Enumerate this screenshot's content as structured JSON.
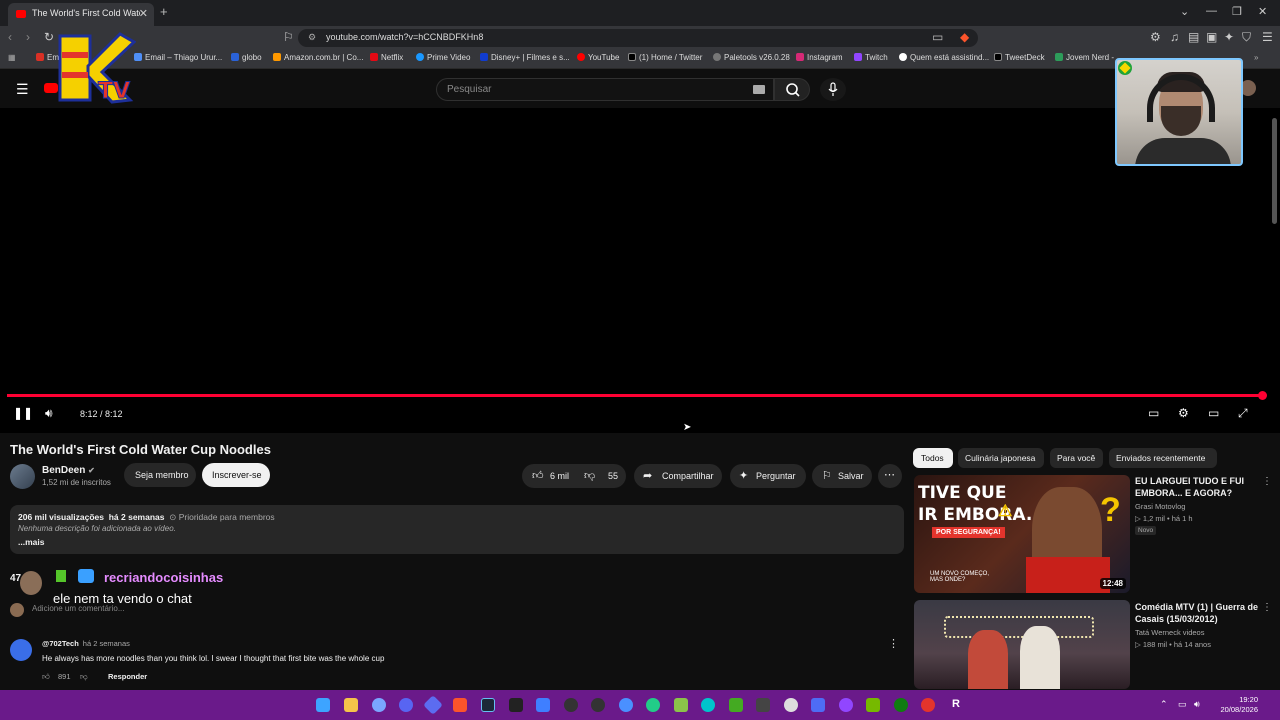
{
  "browser": {
    "tab_title": "The World's First Cold Water Cup Noodles",
    "url": "youtube.com/watch?v=hCCNBDFKHn8",
    "bookmarks": [
      "Em",
      "Email – Thiago Urur...",
      "globo",
      "Amazon.com.br | Co...",
      "Netflix",
      "Prime Video",
      "Disney+ | Filmes e s...",
      "YouTube",
      "(1) Home / Twitter",
      "Paletools v26.0.28",
      "Instagram",
      "Twitch",
      "Quem está assistind...",
      "TweetDeck",
      "Jovem Nerd -"
    ]
  },
  "yt_header": {
    "search_placeholder": "Pesquisar"
  },
  "overlay": {
    "logo_text": "KTV"
  },
  "player": {
    "time": "8:12 / 8:12",
    "progress": 1.0
  },
  "video": {
    "title": "The World's First Cold Water Cup Noodles",
    "channel": "BenDeen",
    "subscribers": "1,52 mi de inscritos",
    "member_label": "Seja membro",
    "subscribe_label": "Inscrever-se",
    "likes": "6 mil",
    "dislikes": "55",
    "share_label": "Compartilhar",
    "ask_label": "Perguntar",
    "save_label": "Salvar"
  },
  "description": {
    "views": "206 mil visualizações",
    "age": "há 2 semanas",
    "priority": "Prioridade para membros",
    "text": "Nenhuma descrição foi adicionada ao vídeo.",
    "more": "...mais"
  },
  "comments": {
    "count_fragment": "47",
    "add_placeholder": "Adicione um comentário...",
    "chat_user": "recriandocoisinhas",
    "chat_message": "ele nem ta vendo o chat",
    "first": {
      "author": "@702Tech",
      "age": "há 2 semanas",
      "text": "He always has more noodles than you think lol. I swear I thought that first bite was the whole cup",
      "likes": "891",
      "reply_label": "Responder"
    }
  },
  "sidebar": {
    "chips": [
      "Todos",
      "Culinária japonesa",
      "Para você",
      "Enviados recentemente"
    ],
    "recs": [
      {
        "title": "EU LARGUEI TUDO E FUI EMBORA... E AGORA?",
        "channel": "Grasi Motovlog",
        "meta": "▷ 1,2 mil • há 1 h",
        "badge": "Novo",
        "duration": "12:48",
        "thumb_text1": "TIVE QUE",
        "thumb_text2": "IR EMBORA...",
        "thumb_text3": "POR SEGURANÇA!",
        "thumb_text4": "UM NOVO COMEÇO, MAS ONDE?"
      },
      {
        "title": "Comédia MTV (1) | Guerra de Casais (15/03/2012)",
        "channel": "Tatá Werneck videos",
        "meta": "▷ 188 mil • há 14 anos"
      }
    ]
  },
  "taskbar": {
    "time": "19:20",
    "date": "20/08/2026"
  }
}
